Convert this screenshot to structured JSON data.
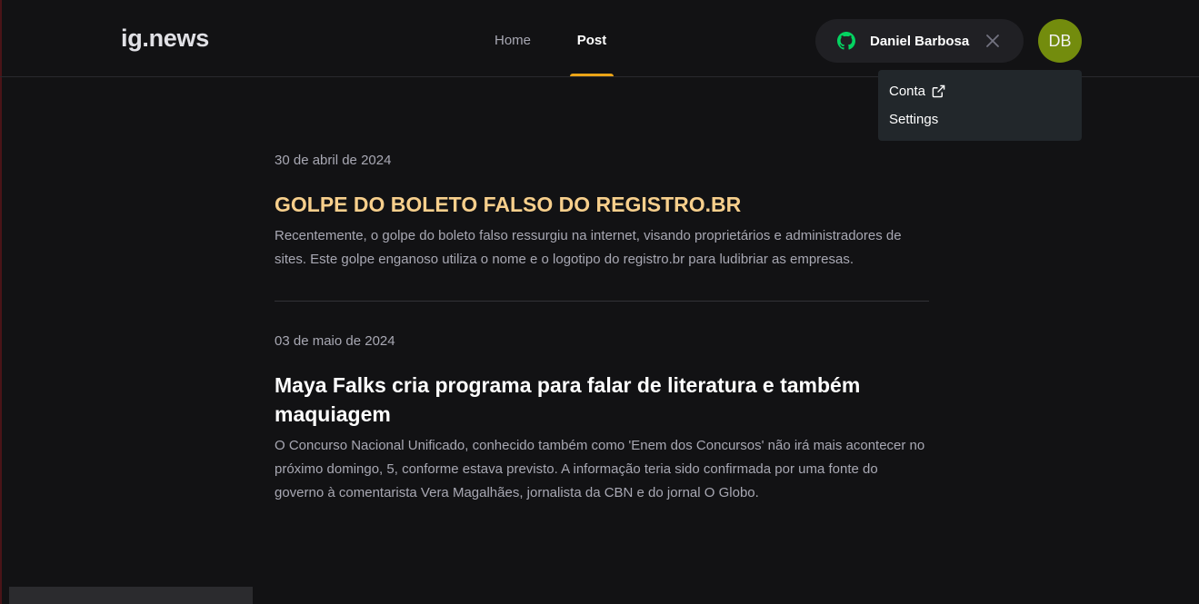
{
  "header": {
    "logo": "ig.news",
    "nav": [
      {
        "label": "Home",
        "active": false
      },
      {
        "label": "Post",
        "active": true
      }
    ],
    "user": {
      "name": "Daniel Barbosa",
      "provider_icon": "github-icon",
      "avatar_initials": "DB",
      "avatar_color": "#738c0d",
      "close_icon": "close-icon"
    },
    "accent_color": "#eba417"
  },
  "dropdown": {
    "items": [
      {
        "label": "Conta",
        "icon": "external-link-icon"
      },
      {
        "label": "Settings"
      }
    ]
  },
  "posts": [
    {
      "date": "30 de abril de 2024",
      "title": "GOLPE DO BOLETO FALSO DO REGISTRO.BR",
      "excerpt": "Recentemente, o golpe do boleto falso ressurgiu na internet, visando proprietários e administradores de sites. Este golpe enganoso utiliza o nome e o logotipo do registro.br para ludibriar as empresas.",
      "title_color": "#f7cf8c"
    },
    {
      "date": "03 de maio de 2024",
      "title": "Maya Falks cria programa para falar de literatura e também maquiagem",
      "excerpt": "O Concurso Nacional Unificado, conhecido também como 'Enem dos Concursos' não irá mais acontecer no próximo domingo, 5, conforme estava previsto. A informação teria sido confirmada por uma fonte do governo à comentarista Vera Magalhães, jornalista da CBN e do jornal O Globo.",
      "title_color": "#ffffff"
    }
  ]
}
